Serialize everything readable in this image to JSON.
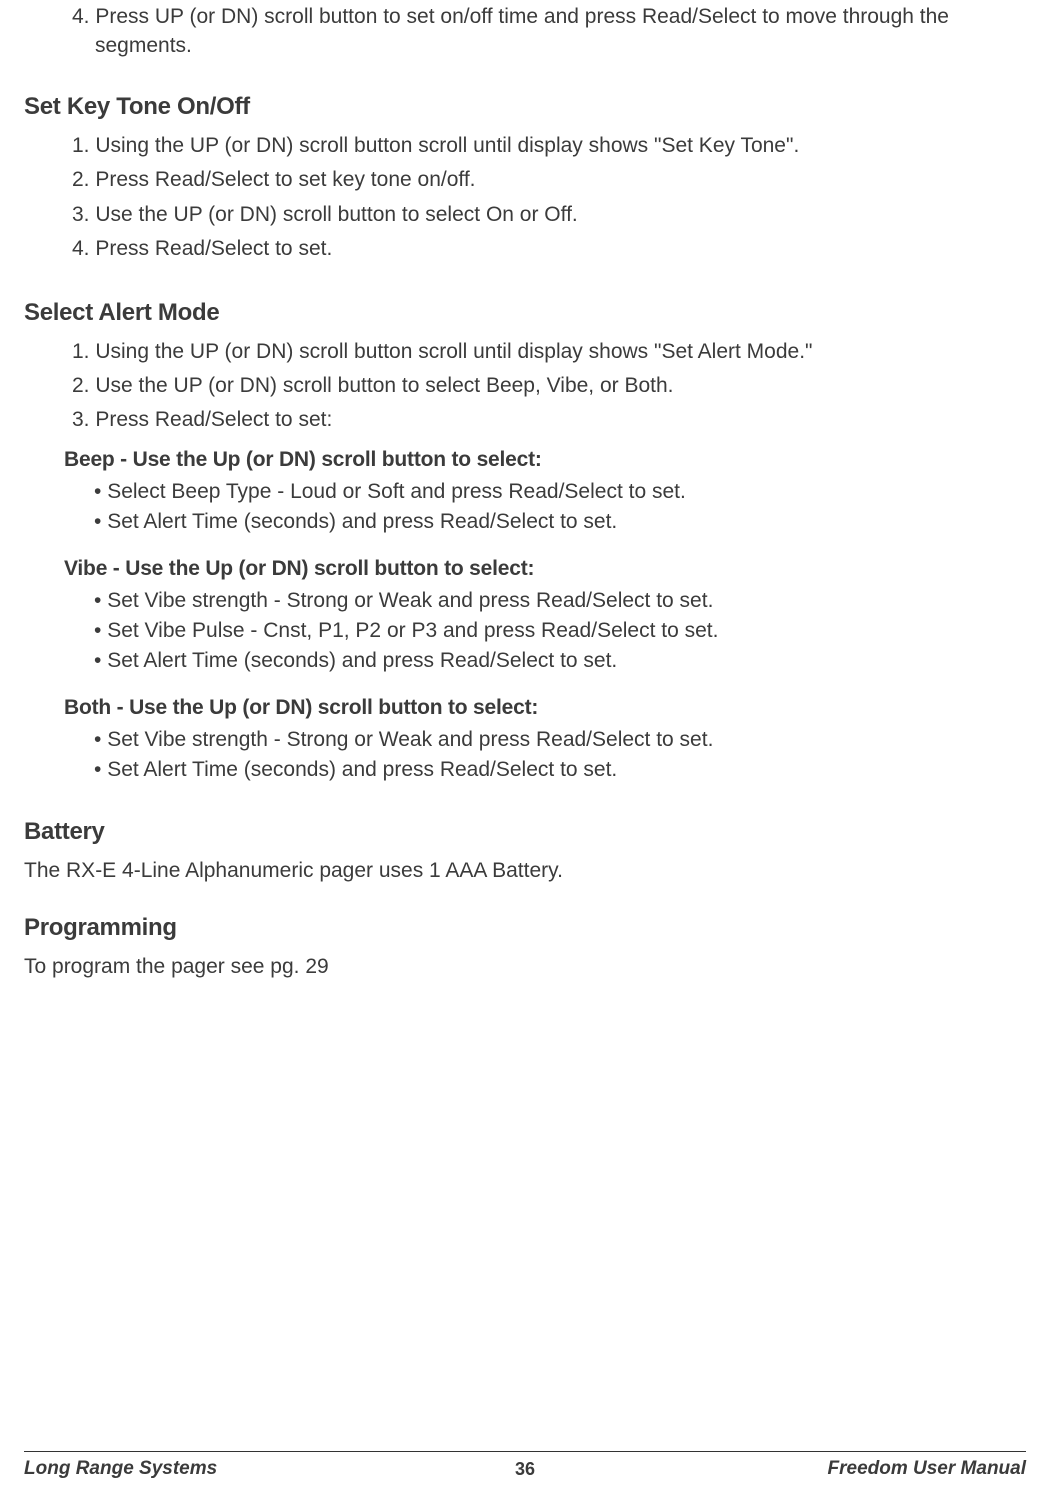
{
  "orphanStep": "4. Press UP (or DN) scroll button to set on/off time and press Read/Select to move through the segments.",
  "sections": {
    "keyTone": {
      "heading": "Set Key Tone On/Off",
      "steps": [
        "1. Using the UP (or DN) scroll button scroll until display shows \"Set Key Tone\".",
        "2. Press Read/Select to set key tone on/off.",
        "3. Use the UP (or DN) scroll button to select On or Off.",
        "4. Press Read/Select to set."
      ]
    },
    "alertMode": {
      "heading": "Select Alert Mode",
      "steps": [
        "1. Using the UP (or DN) scroll button scroll until display shows \"Set Alert Mode.\"",
        "2. Use the UP (or DN) scroll button to select Beep, Vibe, or Both.",
        "3. Press Read/Select to set:"
      ],
      "subsections": [
        {
          "heading": "Beep - Use the Up (or DN) scroll button to select:",
          "bullets": [
            "Select Beep Type - Loud or Soft and press Read/Select to set.",
            "Set Alert Time (seconds) and press Read/Select to set."
          ]
        },
        {
          "heading": "Vibe - Use the Up (or DN) scroll button to select:",
          "bullets": [
            "Set Vibe strength - Strong or Weak and press Read/Select to set.",
            "Set Vibe Pulse - Cnst, P1, P2 or P3 and press Read/Select to set.",
            "Set Alert Time (seconds) and press Read/Select to set."
          ]
        },
        {
          "heading": "Both - Use the Up (or DN) scroll button to select:",
          "bullets": [
            "Set Vibe strength - Strong or Weak and press Read/Select to set.",
            "Set Alert Time (seconds) and press Read/Select to set."
          ]
        }
      ]
    },
    "battery": {
      "heading": "Battery",
      "text": "The RX-E 4-Line Alphanumeric pager uses 1 AAA Battery."
    },
    "programming": {
      "heading": "Programming",
      "text": "To program the pager see pg. 29"
    }
  },
  "footer": {
    "left": "Long Range Systems",
    "center": "36",
    "right": "Freedom User Manual"
  }
}
